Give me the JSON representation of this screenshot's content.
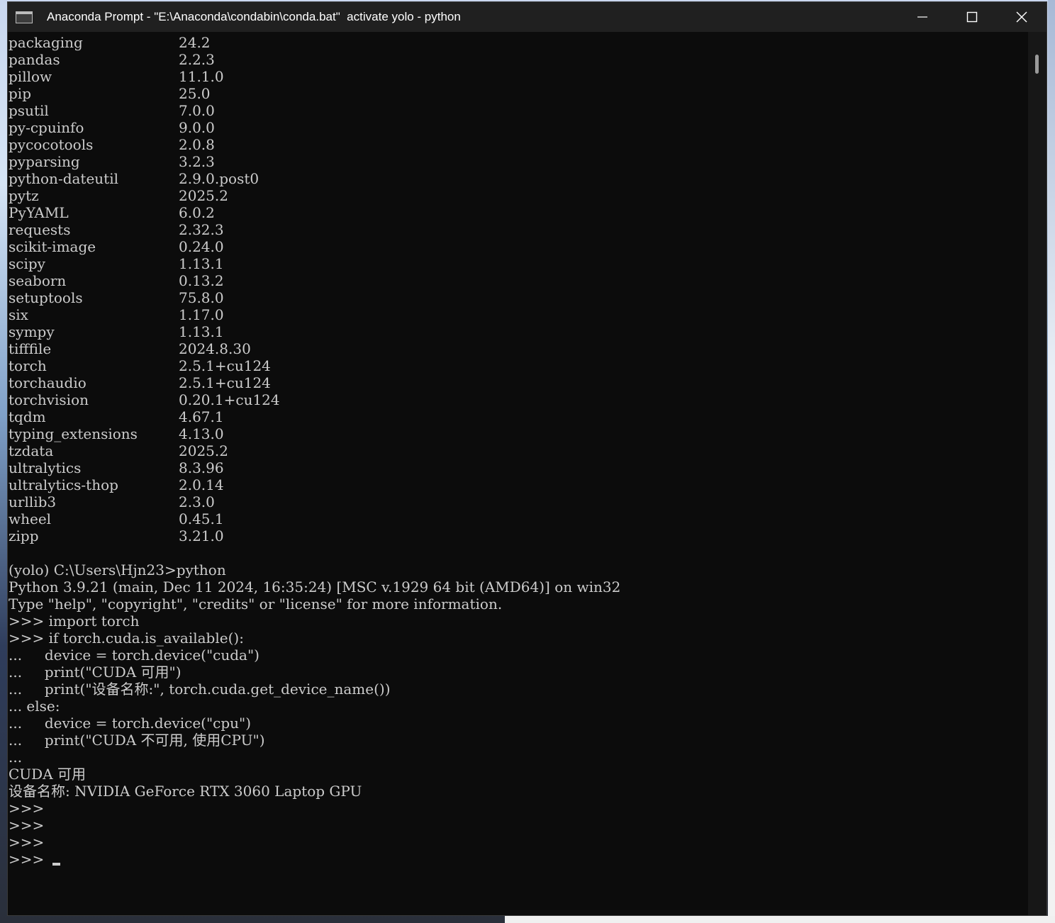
{
  "window": {
    "title": "Anaconda Prompt - \"E:\\Anaconda\\condabin\\conda.bat\"  activate yolo - python",
    "controls": {
      "minimize": "minimize-icon",
      "maximize": "maximize-icon",
      "close": "close-icon"
    }
  },
  "terminal": {
    "packages": [
      {
        "name": "packaging",
        "version": "24.2"
      },
      {
        "name": "pandas",
        "version": "2.2.3"
      },
      {
        "name": "pillow",
        "version": "11.1.0"
      },
      {
        "name": "pip",
        "version": "25.0"
      },
      {
        "name": "psutil",
        "version": "7.0.0"
      },
      {
        "name": "py-cpuinfo",
        "version": "9.0.0"
      },
      {
        "name": "pycocotools",
        "version": "2.0.8"
      },
      {
        "name": "pyparsing",
        "version": "3.2.3"
      },
      {
        "name": "python-dateutil",
        "version": "2.9.0.post0"
      },
      {
        "name": "pytz",
        "version": "2025.2"
      },
      {
        "name": "PyYAML",
        "version": "6.0.2"
      },
      {
        "name": "requests",
        "version": "2.32.3"
      },
      {
        "name": "scikit-image",
        "version": "0.24.0"
      },
      {
        "name": "scipy",
        "version": "1.13.1"
      },
      {
        "name": "seaborn",
        "version": "0.13.2"
      },
      {
        "name": "setuptools",
        "version": "75.8.0"
      },
      {
        "name": "six",
        "version": "1.17.0"
      },
      {
        "name": "sympy",
        "version": "1.13.1"
      },
      {
        "name": "tifffile",
        "version": "2024.8.30"
      },
      {
        "name": "torch",
        "version": "2.5.1+cu124"
      },
      {
        "name": "torchaudio",
        "version": "2.5.1+cu124"
      },
      {
        "name": "torchvision",
        "version": "0.20.1+cu124"
      },
      {
        "name": "tqdm",
        "version": "4.67.1"
      },
      {
        "name": "typing_extensions",
        "version": "4.13.0"
      },
      {
        "name": "tzdata",
        "version": "2025.2"
      },
      {
        "name": "ultralytics",
        "version": "8.3.96"
      },
      {
        "name": "ultralytics-thop",
        "version": "2.0.14"
      },
      {
        "name": "urllib3",
        "version": "2.3.0"
      },
      {
        "name": "wheel",
        "version": "0.45.1"
      },
      {
        "name": "zipp",
        "version": "3.21.0"
      }
    ],
    "session_lines": [
      "",
      "(yolo) C:\\Users\\Hjn23>python",
      "Python 3.9.21 (main, Dec 11 2024, 16:35:24) [MSC v.1929 64 bit (AMD64)] on win32",
      "Type \"help\", \"copyright\", \"credits\" or \"license\" for more information.",
      ">>> import torch",
      ">>> if torch.cuda.is_available():",
      "...     device = torch.device(\"cuda\")",
      "...     print(\"CUDA 可用\")",
      "...     print(\"设备名称:\", torch.cuda.get_device_name())",
      "... else:",
      "...     device = torch.device(\"cpu\")",
      "...     print(\"CUDA 不可用, 使用CPU\")",
      "...",
      "CUDA 可用",
      "设备名称: NVIDIA GeForce RTX 3060 Laptop GPU",
      ">>>",
      ">>>",
      ">>>"
    ],
    "prompt": ">>>"
  }
}
